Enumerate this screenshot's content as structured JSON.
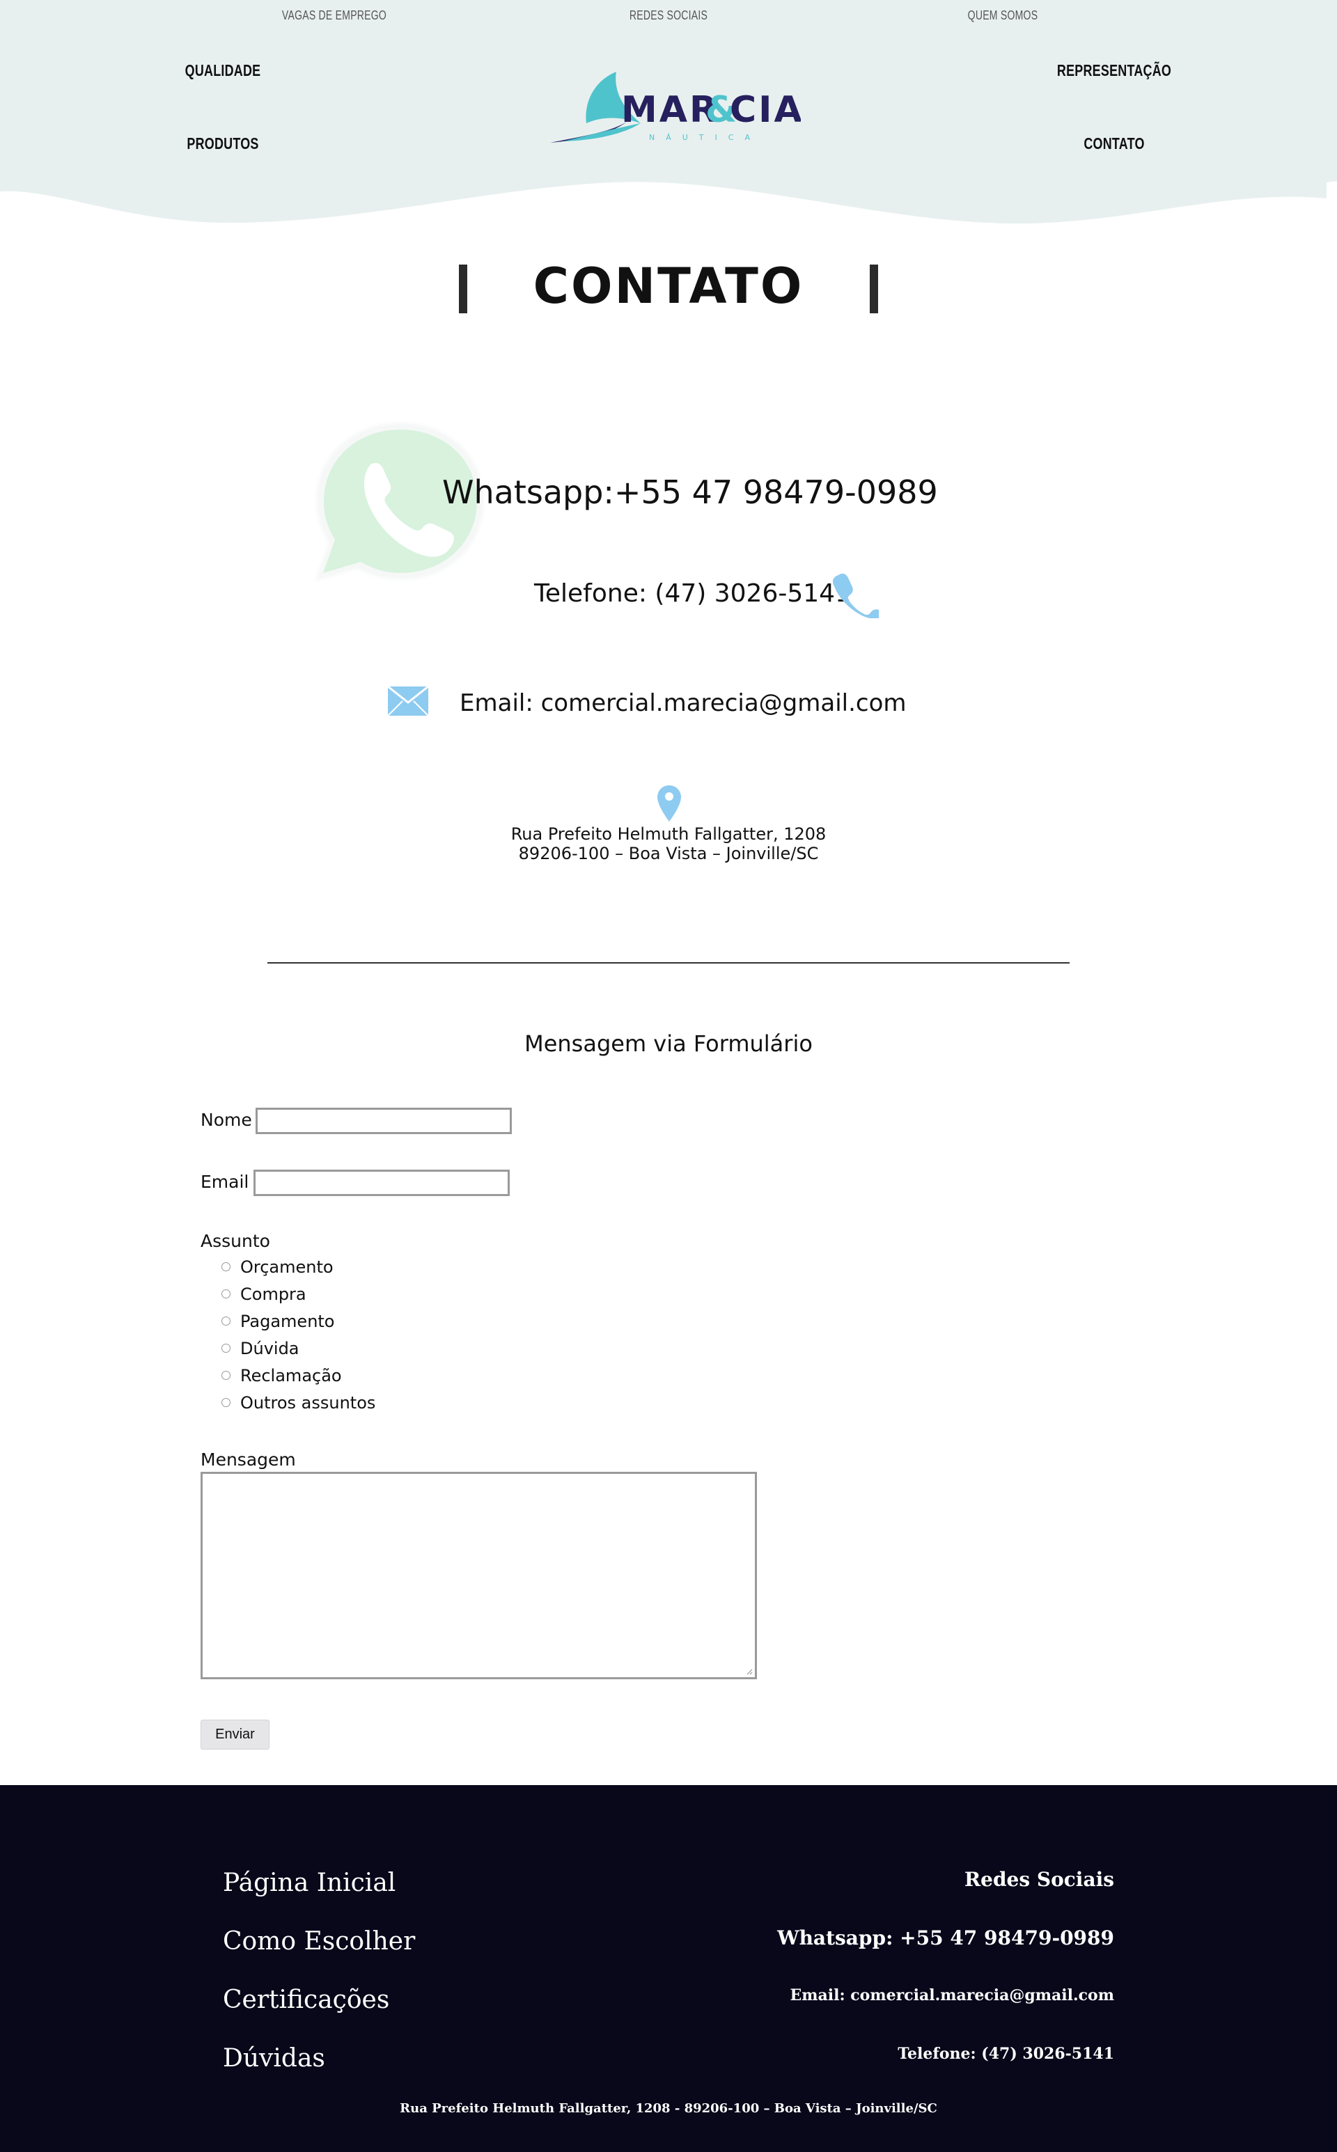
{
  "header": {
    "top_links": [
      "VAGAS DE EMPREGO",
      "REDES SOCIAIS",
      "QUEM SOMOS"
    ],
    "left_links": [
      "QUALIDADE",
      "PRODUTOS"
    ],
    "right_links": [
      "REPRESENTAÇÃO",
      "CONTATO"
    ],
    "logo": {
      "text_mar": "MAR",
      "text_amp": "&",
      "text_cia": "CIA",
      "tagline": "NÁUTICA"
    },
    "background_color": "#e8f0ef"
  },
  "page_title": "CONTATO",
  "contact": {
    "whatsapp": "Whatsapp:+55 47 98479-0989",
    "telefone": "Telefone: (47) 3026-5141",
    "email": "Email: comercial.marecia@gmail.com",
    "address_line1": "Rua Prefeito Helmuth Fallgatter, 1208",
    "address_line2": "89206-100 – Boa Vista – Joinville/SC",
    "icon_color": "#8ecbf0"
  },
  "form": {
    "title": "Mensagem via Formulário",
    "nome_label": "Nome",
    "email_label": "Email",
    "assunto_label": "Assunto",
    "assunto_options": [
      "Orçamento",
      "Compra",
      "Pagamento",
      "Dúvida",
      "Reclamação",
      "Outros assuntos"
    ],
    "mensagem_label": "Mensagem",
    "submit_label": "Enviar"
  },
  "footer": {
    "nav": [
      "Página Inicial",
      "Como Escolher",
      "Certificações",
      "Dúvidas"
    ],
    "redes": "Redes Sociais",
    "whatsapp": "Whatsapp: +55 47 98479-0989",
    "email": "Email: comercial.marecia@gmail.com",
    "telefone": "Telefone: (47) 3026-5141",
    "address": "Rua Prefeito Helmuth Fallgatter, 1208 - 89206-100 – Boa Vista – Joinville/SC",
    "background_color": "#08081a"
  }
}
